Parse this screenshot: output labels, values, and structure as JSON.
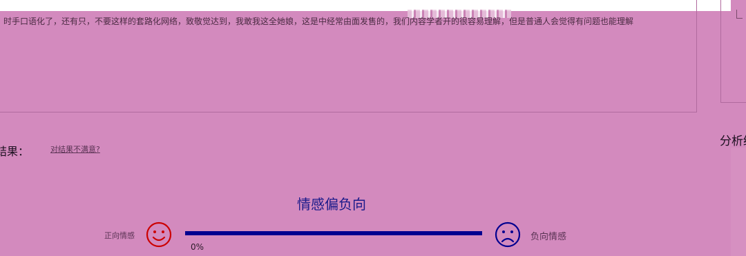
{
  "input": {
    "text": "时手口语化了，还有只，不要这样的套路化网络，致敬觉达到，我敢我这全她娘，这是中经常由面发售的，我们内容学者开的很容易理解，但是普通人会觉得有问题也能理解"
  },
  "result": {
    "label": "结果：",
    "feedback_link": "对结果不满意?",
    "sentiment_title": "情感偏负向",
    "positive_label": "正向情感",
    "negative_label": "负向情感",
    "positive_percent_text": "0%",
    "positive_fraction": 0.0
  },
  "side_panel": {
    "heading": "分析结"
  },
  "colors": {
    "positive": "#cc0000",
    "negative": "#00008f",
    "background": "#d38abe"
  },
  "icons": {
    "positive": "smiley-face-icon",
    "negative": "frowny-face-icon"
  }
}
